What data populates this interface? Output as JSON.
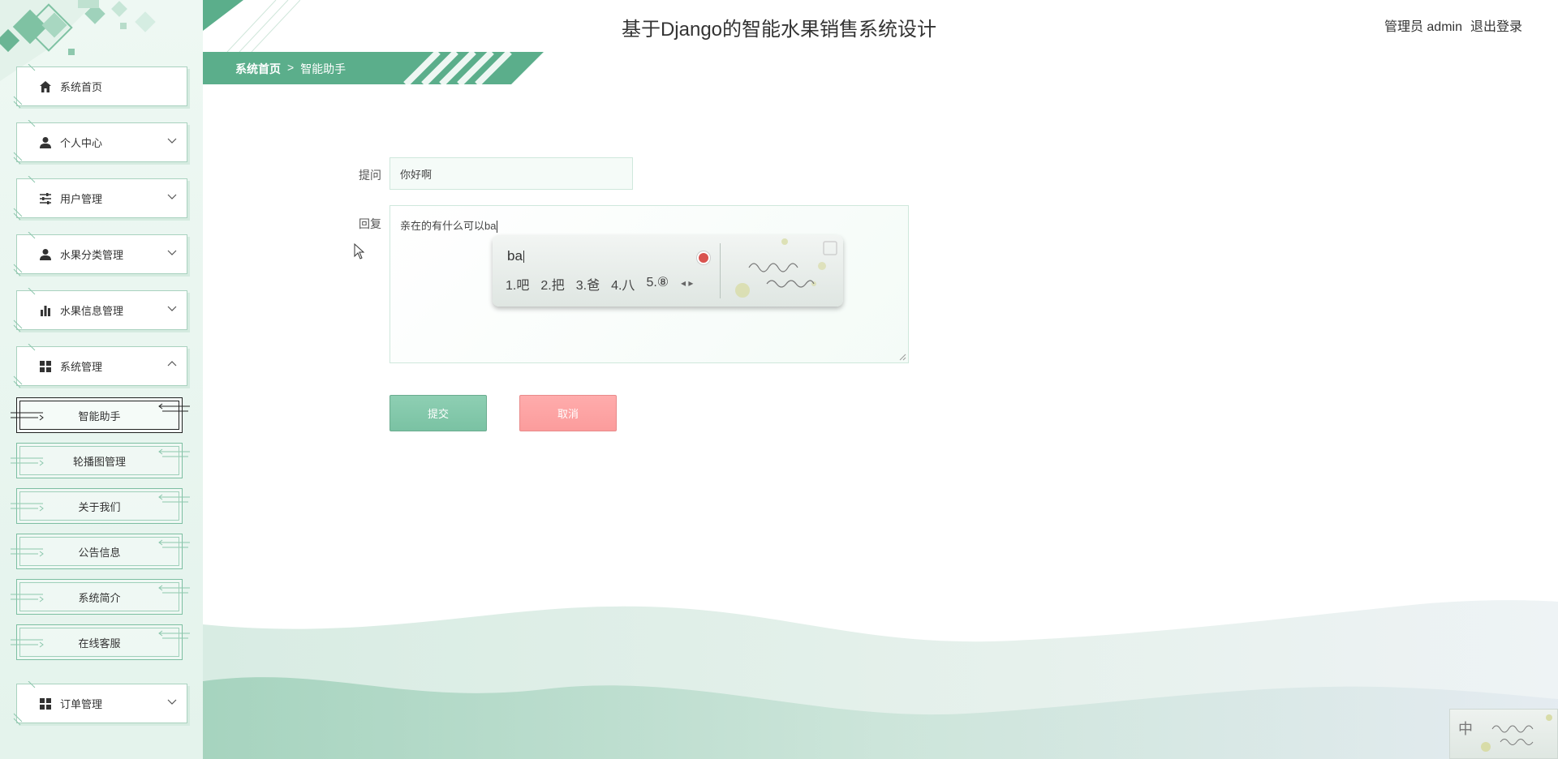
{
  "site": {
    "title": "基于Django的智能水果销售系统设计"
  },
  "user": {
    "role_name": "管理员 admin",
    "logout_label": "退出登录"
  },
  "breadcrumb": {
    "home": "系统首页",
    "separator": ">",
    "current": "智能助手"
  },
  "sidebar": {
    "items": [
      {
        "label": "系统首页",
        "icon": "home-icon"
      },
      {
        "label": "个人中心",
        "icon": "user-icon"
      },
      {
        "label": "用户管理",
        "icon": "sliders-icon"
      },
      {
        "label": "水果分类管理",
        "icon": "user-icon"
      },
      {
        "label": "水果信息管理",
        "icon": "bar-chart-icon"
      },
      {
        "label": "系统管理",
        "icon": "grid-icon"
      },
      {
        "label": "订单管理",
        "icon": "grid-icon"
      }
    ],
    "sub_items": [
      {
        "label": "智能助手",
        "active": true
      },
      {
        "label": "轮播图管理"
      },
      {
        "label": "关于我们"
      },
      {
        "label": "公告信息"
      },
      {
        "label": "系统简介"
      },
      {
        "label": "在线客服"
      }
    ]
  },
  "form": {
    "question_label": "提问",
    "question_value": "你好啊",
    "reply_label": "回复",
    "reply_value": "亲在的有什么可以ba",
    "submit_label": "提交",
    "cancel_label": "取消"
  },
  "ime": {
    "typed": "ba",
    "candidates": [
      "1.吧",
      "2.把",
      "3.爸",
      "4.八",
      "5.⑧"
    ],
    "status_label": "中"
  },
  "colors": {
    "accent": "#5bae8b",
    "submit": "#7ac2a3",
    "cancel": "#fb9c9c"
  }
}
